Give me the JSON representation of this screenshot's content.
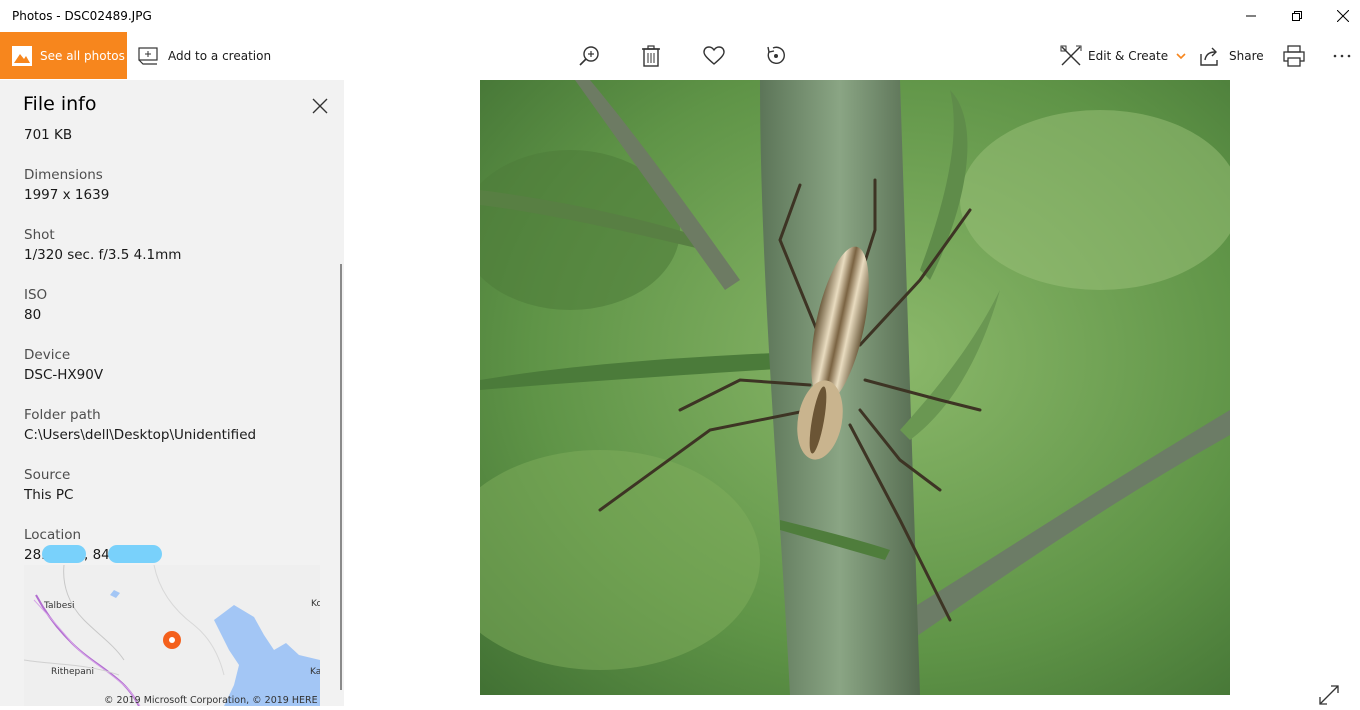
{
  "window": {
    "title": "Photos - DSC02489.JPG"
  },
  "toolbar": {
    "see_all_photos": "See all photos",
    "add_to_creation": "Add to a creation",
    "edit_create": "Edit & Create",
    "share": "Share"
  },
  "file_info": {
    "title": "File info",
    "size": "701 KB",
    "fields": [
      {
        "label": "Dimensions",
        "value": "1997 x 1639"
      },
      {
        "label": "Shot",
        "value": "1/320 sec. f/3.5 4.1mm"
      },
      {
        "label": "ISO",
        "value": "80"
      },
      {
        "label": "Device",
        "value": "DSC-HX90V"
      },
      {
        "label": "Folder path",
        "value": "C:\\Users\\dell\\Desktop\\Unidentified"
      },
      {
        "label": "Source",
        "value": "This PC"
      },
      {
        "label": "Location",
        "value_lat_prefix": "28.",
        "value_lon_prefix": ", 84."
      }
    ]
  },
  "map": {
    "labels": [
      "Talbesi",
      "Rithepani",
      "Ko",
      "Ka"
    ],
    "copyright": "© 2019 Microsoft Corporation, © 2019 HERE"
  },
  "icons": {
    "see_all": "landscape-photo-icon",
    "add_creation": "add-to-creation-icon",
    "zoom": "zoom-in-icon",
    "delete": "trash-icon",
    "favorite": "heart-icon",
    "rotate": "rotate-icon",
    "edit": "edit-create-icon",
    "share": "share-icon",
    "print": "print-icon",
    "more": "more-icon",
    "expand": "expand-icon"
  },
  "colors": {
    "accent": "#f7861d",
    "panel": "#f2f2f2",
    "map_water": "#a3c6f5",
    "map_pin": "#f4601c"
  }
}
